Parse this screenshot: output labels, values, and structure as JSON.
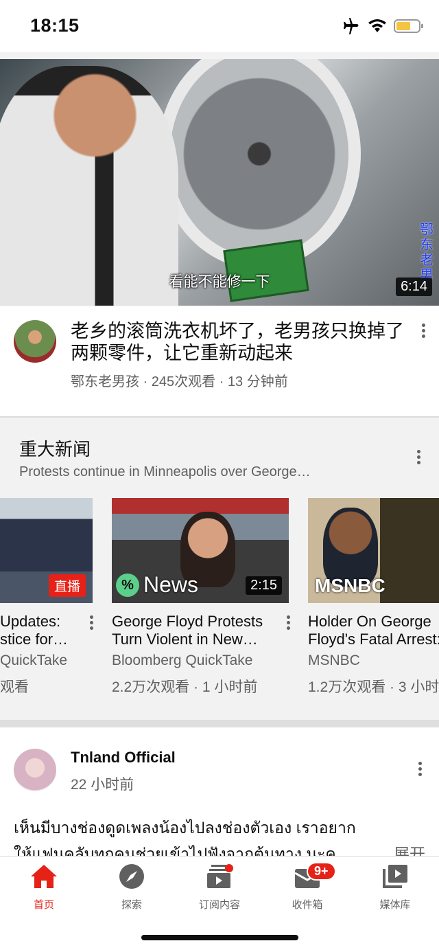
{
  "status": {
    "time": "18:15"
  },
  "hero": {
    "caption": "看能不能修一下",
    "side_label": "鄂东老男",
    "duration": "6:14",
    "title": "老乡的滚筒洗衣机坏了，老男孩只换掉了两颗零件，让它重新动起来",
    "meta": "鄂东老男孩 · 245次观看 · 13 分钟前"
  },
  "news": {
    "heading": "重大新闻",
    "subheading": "Protests continue in Minneapolis over George…",
    "cards": [
      {
        "badge": "直播",
        "title_line1": "Updates:",
        "title_line2": "stice for…",
        "channel": "QuickTake",
        "stats": "观看"
      },
      {
        "overlay": "News",
        "duration": "2:15",
        "title_line1": "George Floyd Protests",
        "title_line2": "Turn Violent in New…",
        "channel": "Bloomberg QuickTake",
        "stats": "2.2万次观看 · 1 小时前"
      },
      {
        "overlay": "MSNBC",
        "title_line1": "Holder On George",
        "title_line2": "Floyd's Fatal Arrest:",
        "channel": "MSNBC",
        "stats": "1.2万次观看 · 3 小时"
      }
    ]
  },
  "post": {
    "author": "Tnland Official",
    "time": "22 小时前",
    "text_line1": "เห็นมีบางช่องดูดเพลงน้องไปลงช่องตัวเอง เราอยาก",
    "text_line2": "ให้แฟนคลับทุกคนช่วยเข้าไปฟังจากต้นทาง นะค",
    "expand": "展开"
  },
  "tabs": [
    {
      "label": "首页",
      "icon": "home-icon"
    },
    {
      "label": "探索",
      "icon": "explore-icon"
    },
    {
      "label": "订阅内容",
      "icon": "subscriptions-icon"
    },
    {
      "label": "收件箱",
      "icon": "inbox-icon",
      "badge": "9+"
    },
    {
      "label": "媒体库",
      "icon": "library-icon"
    }
  ],
  "colors": {
    "accent": "#e62117",
    "text": "#0f0f0f",
    "secondary": "#606060"
  }
}
